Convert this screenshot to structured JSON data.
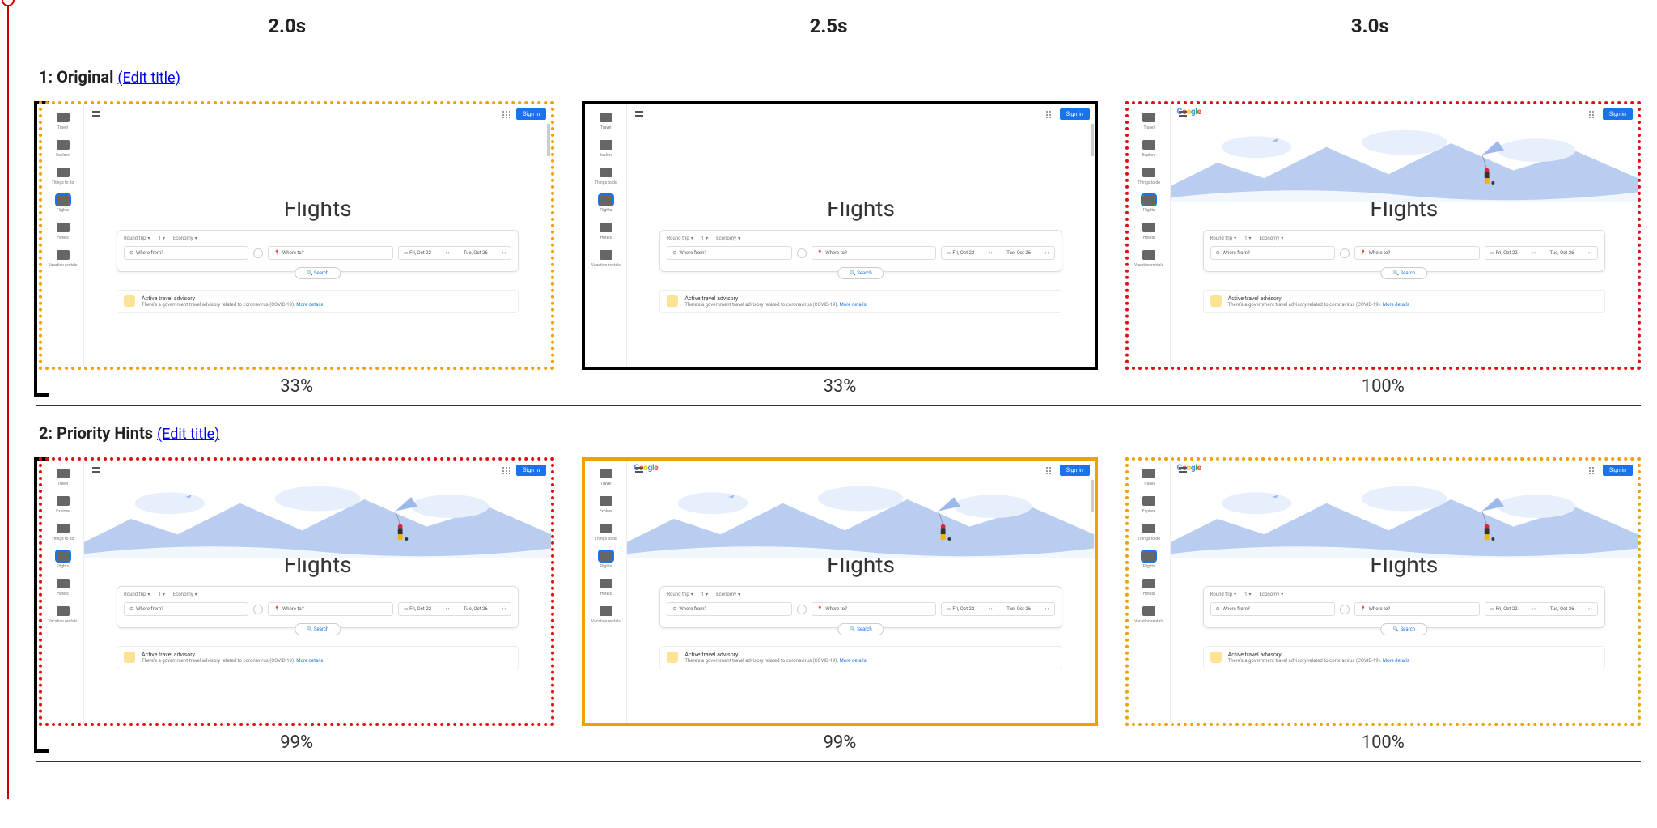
{
  "time_points": [
    "2.0s",
    "2.5s",
    "3.0s"
  ],
  "rows": [
    {
      "idx": "1",
      "title": "Original",
      "edit_label": "(Edit title)",
      "frames": [
        {
          "border": "dotted-orange",
          "percent": "33%",
          "hero": "blank",
          "show_logo": false,
          "scrollbar": true
        },
        {
          "border": "solid-black",
          "percent": "33%",
          "hero": "blank",
          "show_logo": false,
          "scrollbar": true
        },
        {
          "border": "dotted-red",
          "percent": "100%",
          "hero": "illus",
          "show_logo": true,
          "scrollbar": false
        }
      ]
    },
    {
      "idx": "2",
      "title": "Priority Hints",
      "edit_label": "(Edit title)",
      "frames": [
        {
          "border": "dotted-red",
          "percent": "99%",
          "hero": "illus",
          "show_logo": false,
          "scrollbar": false
        },
        {
          "border": "solid-orange",
          "percent": "99%",
          "hero": "illus",
          "show_logo": true,
          "scrollbar": true
        },
        {
          "border": "dotted-orange",
          "percent": "100%",
          "hero": "illus",
          "show_logo": true,
          "scrollbar": false
        }
      ]
    }
  ],
  "shot": {
    "signin": "Sign in",
    "logo_chars": [
      "G",
      "o",
      "o",
      "g",
      "l",
      "e"
    ],
    "sidebar": [
      {
        "label": "Travel"
      },
      {
        "label": "Explore"
      },
      {
        "label": "Things to do"
      },
      {
        "label": "Flights",
        "sel": true
      },
      {
        "label": "Hotels"
      },
      {
        "label": "Vacation rentals"
      }
    ],
    "heading": "Flights",
    "trip_type": "Round trip",
    "pax": "1",
    "cabin": "Economy",
    "where_from": "Where from?",
    "where_to": "Where to?",
    "date_out": "Fri, Oct 22",
    "date_in": "Tue, Oct 26",
    "search_btn": "Search",
    "advisory_title": "Active travel advisory",
    "advisory_desc": "There's a government travel advisory related to coronavirus (COVID-19).",
    "advisory_more": "More details"
  }
}
